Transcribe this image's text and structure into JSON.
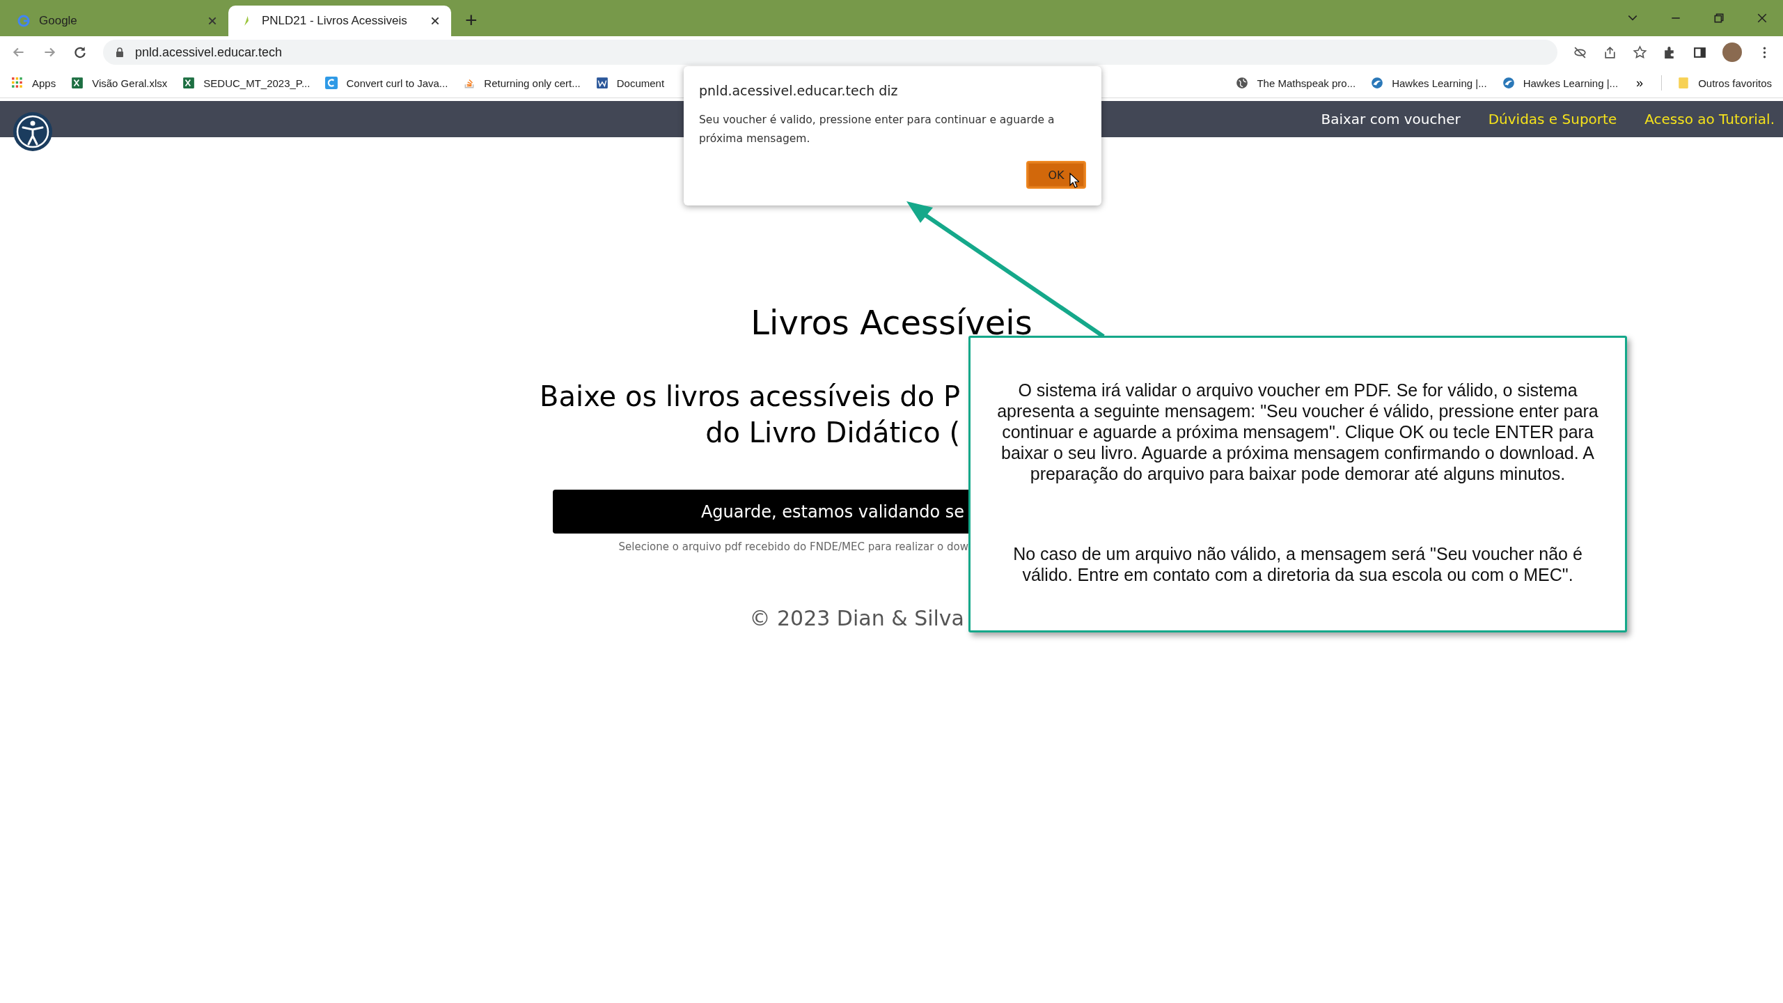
{
  "tabs": [
    {
      "title": "Google",
      "selected": false,
      "kind": "google"
    },
    {
      "title": "PNLD21 - Livros Acessiveis",
      "selected": true,
      "kind": "site"
    }
  ],
  "new_tab": "+",
  "address_bar": {
    "url": "pnld.acessivel.educar.tech"
  },
  "bookmarks": [
    {
      "label": "Apps",
      "kind": "apps"
    },
    {
      "label": "Visão Geral.xlsx",
      "kind": "excel"
    },
    {
      "label": "SEDUC_MT_2023_P...",
      "kind": "excel"
    },
    {
      "label": "Convert curl to Java...",
      "kind": "curl"
    },
    {
      "label": "Returning only cert...",
      "kind": "stack"
    },
    {
      "label": "Document",
      "kind": "word"
    }
  ],
  "bookmarks_right": [
    {
      "label": "The Mathspeak pro...",
      "kind": "globe"
    },
    {
      "label": "Hawkes Learning |...",
      "kind": "hawkes"
    },
    {
      "label": "Hawkes Learning |...",
      "kind": "hawkes"
    }
  ],
  "bookmarks_overflow": "»",
  "other_bookmarks": "Outros favoritos",
  "site_nav": [
    {
      "label": "Baixar com voucher",
      "color": "#ffffff"
    },
    {
      "label": "Dúvidas e Suporte",
      "color": "#f5e21b"
    },
    {
      "label": "Acesso ao Tutorial.",
      "color": "#f5e21b"
    }
  ],
  "page": {
    "title": "Livros Acessíveis",
    "subtitle_lines": [
      "Baixe os livros acessíveis do P",
      "do Livro Didático ("
    ],
    "button": "Aguarde, estamos validando se",
    "hint": "Selecione o arquivo pdf recebido do FNDE/MEC para realizar o dow",
    "footer": "© 2023 Dian & Silva"
  },
  "dialog": {
    "title": "pnld.acessivel.educar.tech diz",
    "message": "Seu voucher é valido, pressione enter para continuar e aguarde a próxima mensagem.",
    "ok": "OK"
  },
  "callout": {
    "paragraphs": [
      "O sistema irá validar o arquivo voucher em PDF. Se for válido, o sistema apresenta a seguinte mensagem: \"Seu voucher é válido, pressione enter para continuar e aguarde a próxima mensagem\". Clique OK ou tecle ENTER para baixar o seu livro. Aguarde a próxima mensagem confirmando o download. A preparação do arquivo para baixar pode demorar até alguns minutos.",
      "No caso de um arquivo não válido, a mensagem será \"Seu voucher não é válido. Entre em contato com a diretoria da sua escola ou com o MEC\"."
    ]
  }
}
